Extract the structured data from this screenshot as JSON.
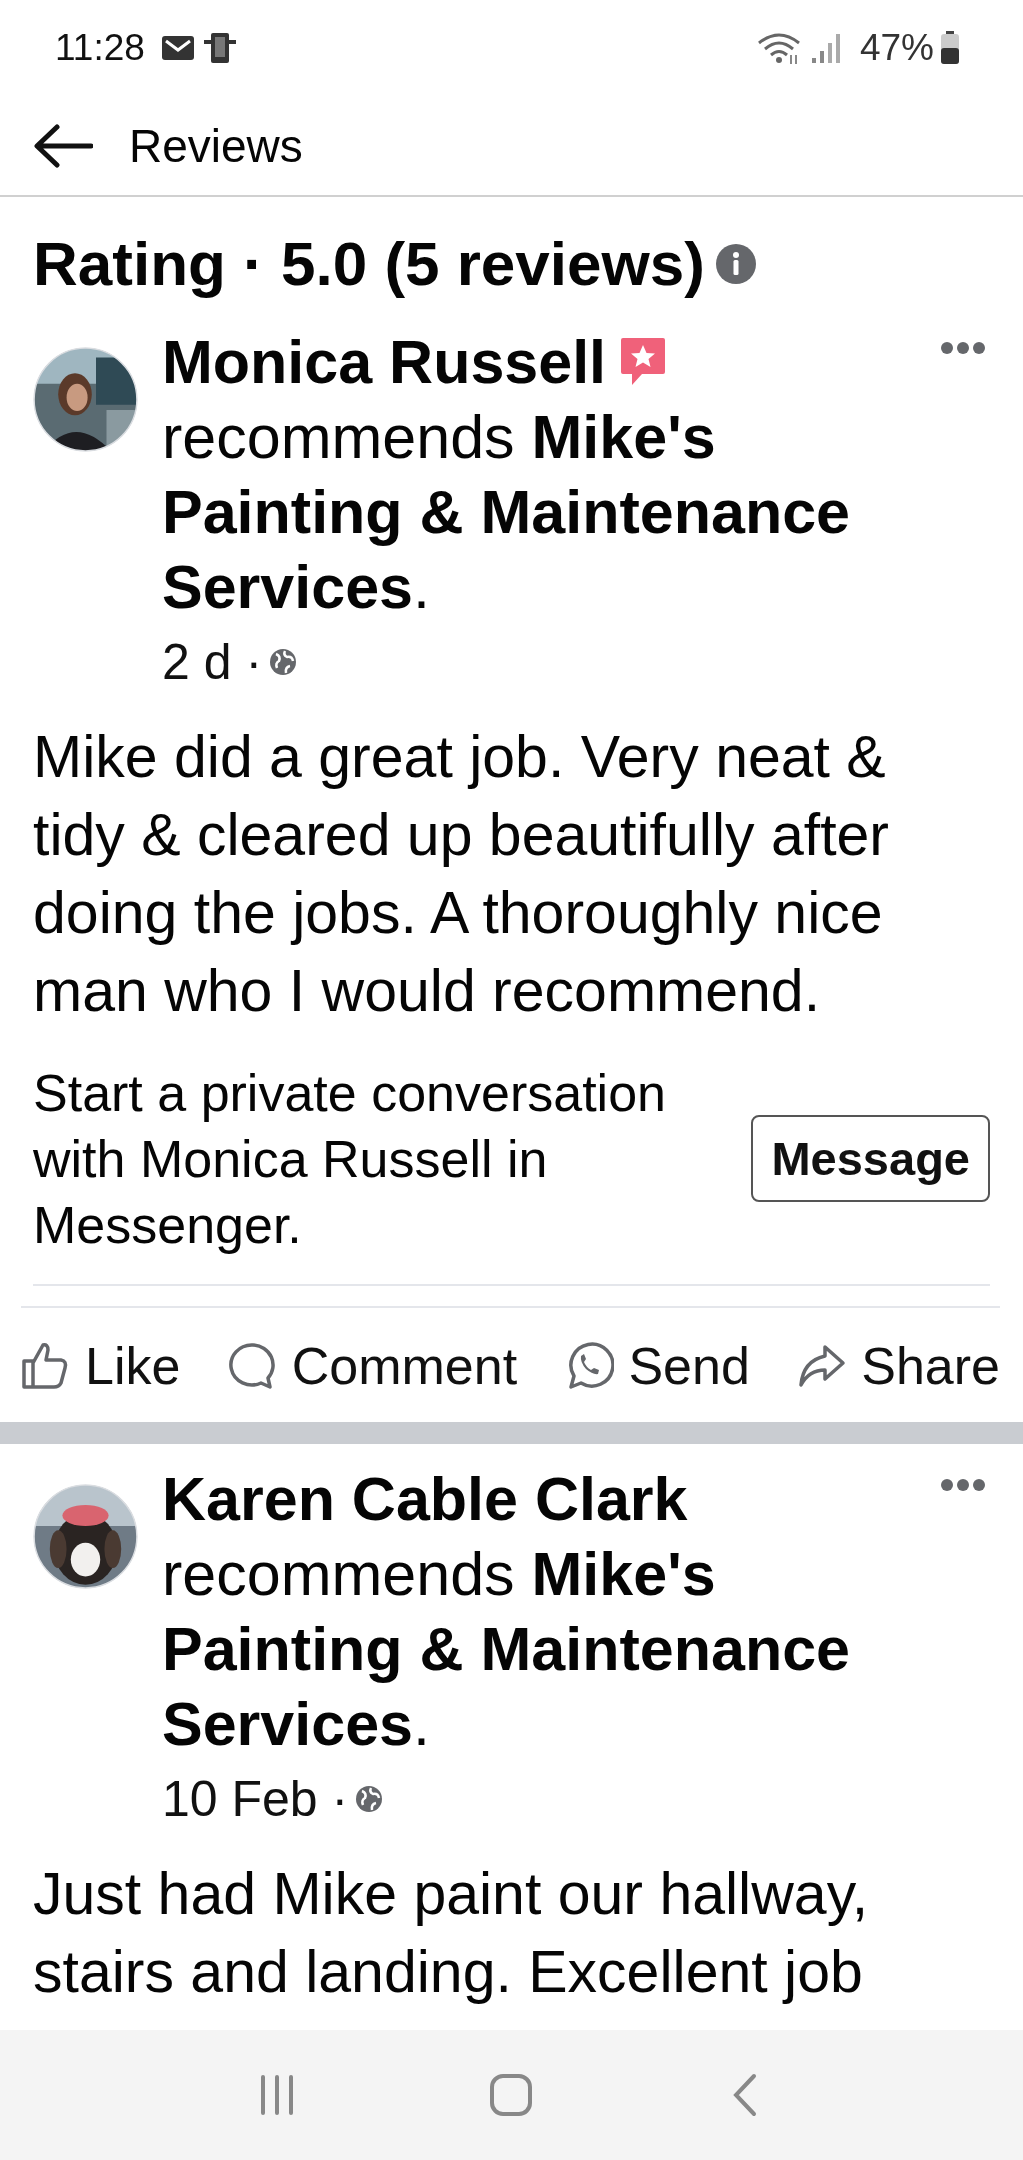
{
  "status_bar": {
    "time": "11:28",
    "battery": "47%"
  },
  "header": {
    "title": "Reviews"
  },
  "rating": {
    "title": "Rating · 5.0 (5 reviews)"
  },
  "reviews": [
    {
      "author": "Monica Russell",
      "recommender_badge": true,
      "recommends": "recommends **Mike's Painting & Maintenance Services**.",
      "date": "2 d ·",
      "text": "Mike did a great job. Very neat & tidy & cleared up beautifully after doing the jobs. A thoroughly nice man who I would recommend.",
      "message_prompt": "Start a private conversation with Monica Russell in Messenger.",
      "message_button": "Message",
      "actions": [
        {
          "kind": "like",
          "label": "Like"
        },
        {
          "kind": "comment",
          "label": "Comment"
        },
        {
          "kind": "send",
          "label": "Send"
        },
        {
          "kind": "share",
          "label": "Share"
        }
      ]
    },
    {
      "author": "Karen Cable Clark",
      "recommender_badge": false,
      "recommends": "recommends **Mike's Painting & Maintenance Services**.",
      "date": "10 Feb ·",
      "text": "Just had Mike paint our hallway, stairs and landing. Excellent job"
    }
  ]
}
